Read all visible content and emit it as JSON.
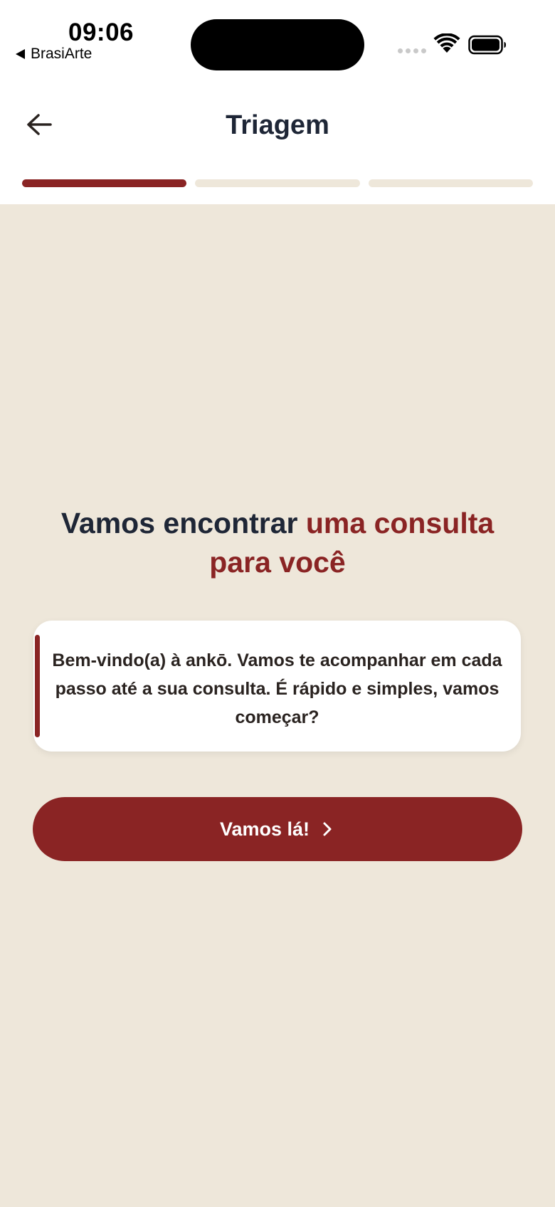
{
  "status_bar": {
    "time": "09:06",
    "back_app": "BrasiArte"
  },
  "header": {
    "title": "Triagem",
    "back_icon": "arrow-left-icon"
  },
  "progress": {
    "total_steps": 3,
    "current_step": 1
  },
  "main": {
    "headline_part1": "Vamos encontrar ",
    "headline_part2": "uma consulta para você",
    "message": "Bem-vindo(a) à ankō. Vamos te acompanhar em cada passo até a sua consulta. É rápido e simples, vamos começar?",
    "cta_label": "Vamos lá!",
    "cta_icon": "chevron-right-icon"
  },
  "colors": {
    "accent": "#8A2424",
    "title": "#1E2636",
    "background": "#EEE7DA",
    "card": "#FFFFFF"
  }
}
